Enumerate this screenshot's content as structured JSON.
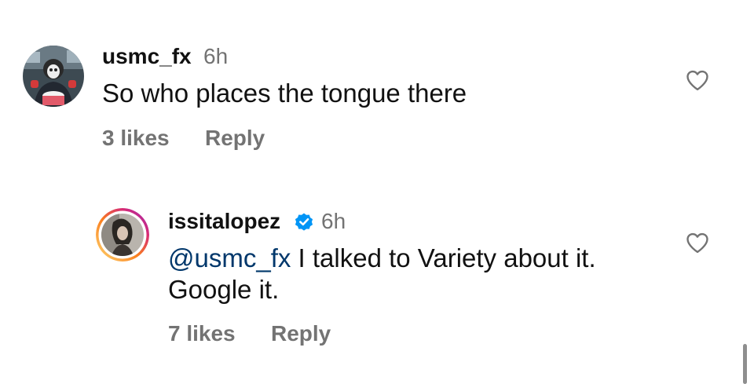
{
  "comments": [
    {
      "username": "usmc_fx",
      "time": "6h",
      "text": "So who places the tongue there",
      "likes": "3 likes",
      "reply_label": "Reply",
      "avatar_icon": "user-photo-avatar",
      "like_icon": "heart-outline-icon"
    },
    {
      "username": "issitalopez",
      "verified": true,
      "verified_icon": "verified-badge-icon",
      "time": "6h",
      "mention": "@usmc_fx",
      "text_after_mention": " I talked to Variety about it. Google it.",
      "likes": "7 likes",
      "reply_label": "Reply",
      "avatar_icon": "user-photo-avatar-story-ring",
      "like_icon": "heart-outline-icon"
    }
  ],
  "colors": {
    "text": "#111111",
    "secondary": "#737373",
    "mention": "#00376b",
    "verified": "#0095f6",
    "story_ring_start": "#feda75",
    "story_ring_end": "#d62976"
  }
}
